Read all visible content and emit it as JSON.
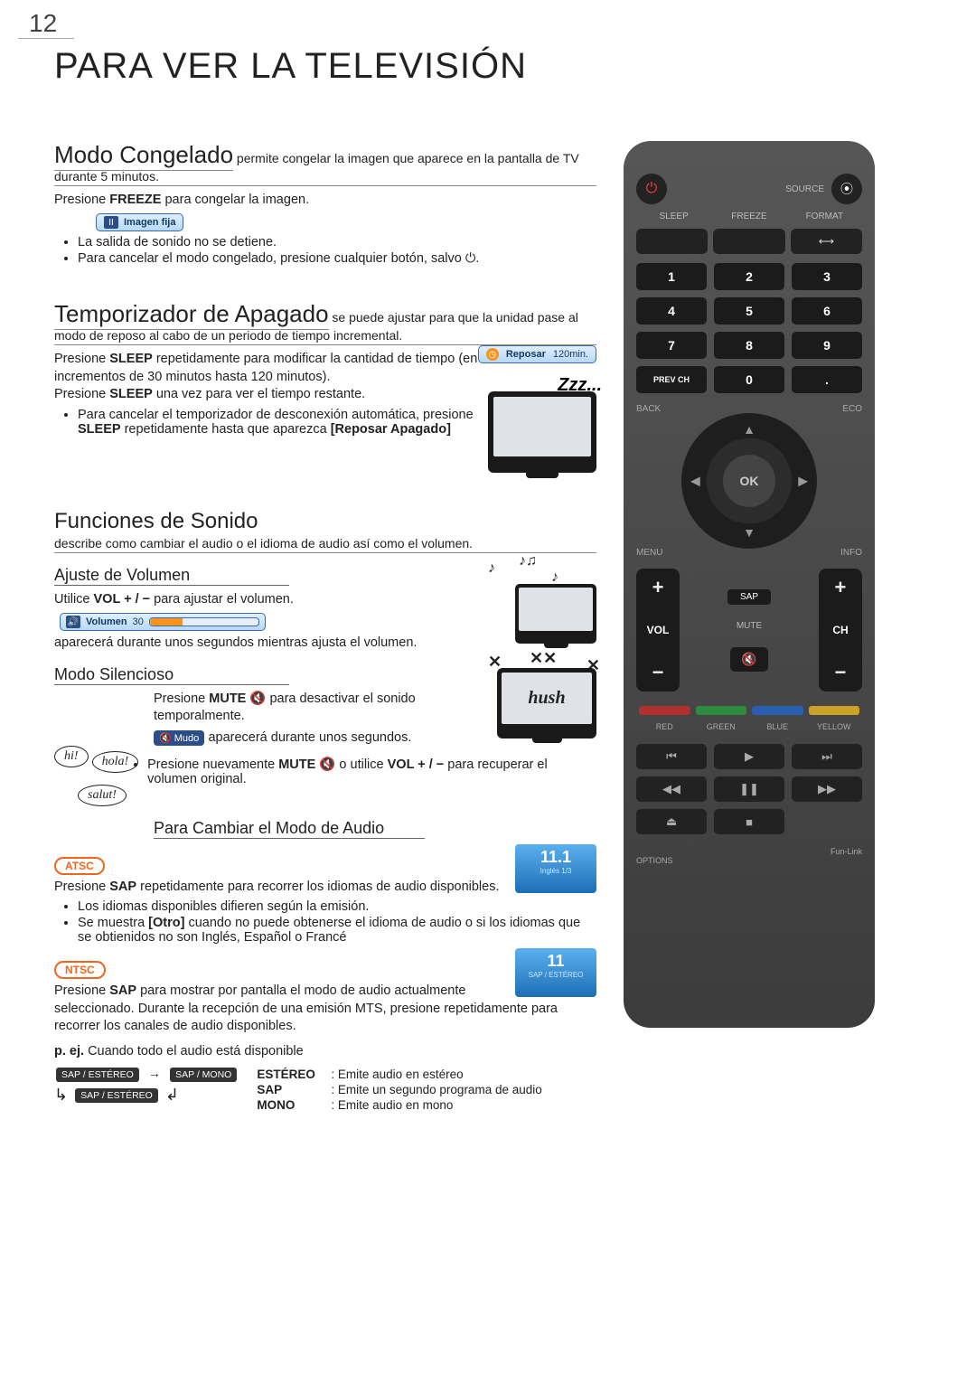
{
  "page_number": "12",
  "page_title": "PARA VER LA TELEVISIÓN",
  "freeze": {
    "heading": "Modo Congelado",
    "heading_sub": " permite congelar la imagen que aparece en la pantalla de TV",
    "heading_sub2": "durante 5 minutos.",
    "instr": "Presione FREEZE para congelar la imagen.",
    "osd_icon": "II",
    "osd_text": "Imagen fija",
    "b1": "La salida de sonido no se detiene.",
    "b2": "Para cancelar el modo congelado, presione cualquier botón, salvo ⏻."
  },
  "sleep": {
    "heading": "Temporizador de Apagado",
    "heading_sub": " se puede ajustar para que la unidad pase al",
    "heading_sub2": "modo de reposo al cabo de un periodo de tiempo incremental.",
    "instr1": "Presione SLEEP repetidamente para modificar la cantidad de tiempo (en incrementos de 30 minutos hasta 120 minutos).",
    "osd_label": "Reposar",
    "osd_time": "120min.",
    "instr2": "Presione SLEEP una vez para ver el tiempo restante.",
    "b1_a": "Para cancelar el temporizador de desconexión automática, presione ",
    "b1_b": "SLEEP",
    "b1_c": " repetidamente hasta que aparezca ",
    "b1_d": "[Reposar Apagado]",
    "zzz": "Zzz..."
  },
  "sound": {
    "heading": "Funciones de Sonido",
    "sub": "describe como cambiar el audio o el idioma de audio así como el volumen.",
    "vol_h": "Ajuste de Volumen",
    "vol_instr_a": "Utilice ",
    "vol_instr_b": "VOL + / −",
    "vol_instr_c": " para ajustar el volumen.",
    "vol_osd_lbl": "Volumen",
    "vol_osd_val": "30",
    "vol_after": "aparecerá durante unos segundos mientras ajusta el volumen.",
    "mute_h": "Modo Silencioso",
    "mute_instr_a": "Presione ",
    "mute_instr_b": "MUTE",
    "mute_instr_c": " 🔇 para desactivar el sonido temporalmente.",
    "mute_pill": "🔇 Mudo",
    "mute_after": " aparecerá durante unos segundos.",
    "mute_b1_a": "Presione nuevamente ",
    "mute_b1_b": "MUTE",
    "mute_b1_c": " 🔇 o utilice ",
    "mute_b1_d": "VOL + / −",
    "mute_b1_e": " para recuperar el volumen original.",
    "hush": "hush",
    "hi": "hi!",
    "hola": "hola!",
    "salut": "salut!",
    "audio_h": "Para Cambiar el Modo de Audio",
    "atsc_tag": "ATSC",
    "atsc_p": "Presione SAP repetidamente para recorrer los idiomas de audio disponibles.",
    "atsc_b1": "Los idiomas disponibles difieren según la emisión.",
    "atsc_b2": "Se muestra [Otro] cuando no puede obtenerse el idioma de audio o si los idiomas que se obtienidos no son Inglés, Español o Francé",
    "atsc_osd_ch": "11.1",
    "atsc_osd_sub": "Inglés 1/3",
    "ntsc_tag": "NTSC",
    "ntsc_p": "Presione SAP para mostrar por pantalla el modo de audio actualmente seleccionado. Durante la recepción de una emisión MTS, presione repetidamente para recorrer los canales de audio disponibles.",
    "ntsc_osd_ch": "11",
    "ntsc_osd_sub": "SAP / ESTÉREO",
    "pej_a": "p. ej.",
    "pej_b": " Cuando todo el audio está disponible",
    "flow1": "SAP / ESTÉREO",
    "flow2": "SAP / MONO",
    "flow3": "SAP / ESTÉREO",
    "leg1_k": "ESTÉREO",
    "leg1_v": ": Emite audio en estéreo",
    "leg2_k": "SAP",
    "leg2_v": ": Emite un segundo programa de audio",
    "leg3_k": "MONO",
    "leg3_v": ": Emite audio en mono"
  },
  "remote": {
    "source": "SOURCE",
    "sleep": "SLEEP",
    "freeze": "FREEZE",
    "format": "FORMAT",
    "nums": [
      "1",
      "2",
      "3",
      "4",
      "5",
      "6",
      "7",
      "8",
      "9"
    ],
    "prev": "PREV CH",
    "zero": "0",
    "dot": ".",
    "back": "BACK",
    "eco": "ECO",
    "menu": "MENU",
    "info": "INFO",
    "ok": "OK",
    "vol": "VOL",
    "ch": "CH",
    "sap": "SAP",
    "mute": "MUTE",
    "red": "RED",
    "green": "GREEN",
    "blue": "BLUE",
    "yellow": "YELLOW",
    "options": "OPTIONS",
    "funlink": "Fun-Link"
  }
}
